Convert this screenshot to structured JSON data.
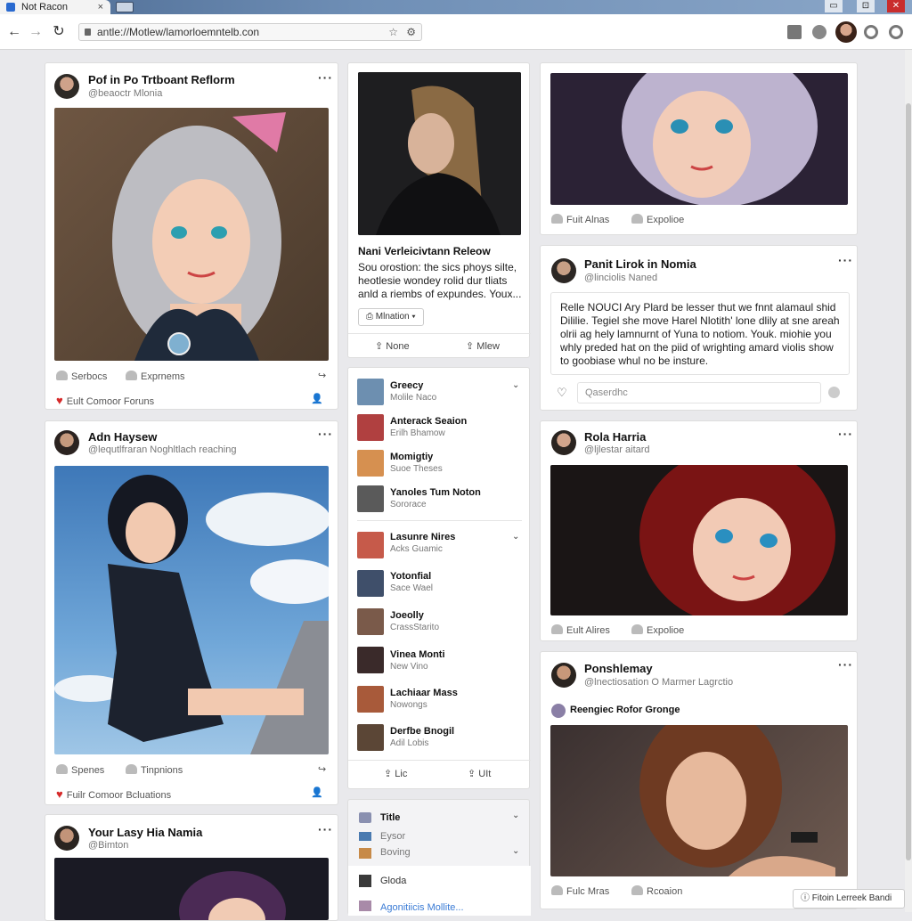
{
  "browser": {
    "tab_title": "Not Racon",
    "url": "antle://Motlew/lamorloemntelb.con",
    "win_controls": [
      "▭",
      "⊡",
      "✕"
    ]
  },
  "colors": {
    "accent": "#2a6ad0",
    "heart": "#d62a2a",
    "link": "#3a7bd5"
  },
  "col1": {
    "post1": {
      "title": "Pof in Po Trtboant Reflorm",
      "handle": "@beaoctr Mlonia",
      "actions": [
        "Serbocs",
        "Exprnems"
      ],
      "footer": "Eult Comoor Foruns"
    },
    "post2": {
      "title": "Adn Haysew",
      "handle": "@lequtlfraran Noghltlach reaching",
      "actions": [
        "Spenes",
        "Tinpnions"
      ],
      "footer": "Fuilr Comoor Bcluations"
    },
    "post3": {
      "title": "Your Lasy Hia Namia",
      "handle": "@Bimton"
    }
  },
  "col2": {
    "article": {
      "title": "Nani Verleicivtann Releow",
      "body": "Sou orostion: the sics phoys silte, heotlesie wondey rolid dur tliats anld a riembs of expundes. Youx...",
      "tag_button": "Mlnation",
      "btn_left": "None",
      "btn_right": "Mlew"
    },
    "people": [
      {
        "name": "Greecy",
        "sub": "Molile Naco"
      },
      {
        "name": "Anterack Seaion",
        "sub": "Erilh Bhamow"
      },
      {
        "name": "Momigtiy",
        "sub": "Suoe Theses"
      },
      {
        "name": "Yanoles Tum Noton",
        "sub": "Sororace"
      },
      {
        "name": "Lasunre Nires",
        "sub": "Acks Guamic"
      },
      {
        "name": "Yotonfial",
        "sub": "Sace Wael"
      },
      {
        "name": "Joeolly",
        "sub": "CrassStarito"
      },
      {
        "name": "Vinea Monti",
        "sub": "New Vino"
      },
      {
        "name": "Lachiaar Mass",
        "sub": "Nowongs"
      },
      {
        "name": "Derfbe Bnogil",
        "sub": "Adil Lobis"
      }
    ],
    "people_btn_left": "Lic",
    "people_btn_right": "UIt",
    "bottom": {
      "title": "Title",
      "items": [
        "Eysor",
        "Boving",
        "Gloda"
      ],
      "link": "Agonitiicis Mollite..."
    }
  },
  "col3": {
    "top": {
      "actions": [
        "Fuit Alnas",
        "Expolioe"
      ]
    },
    "post": {
      "title": "Panit Lirok in Nomia",
      "handle": "@linciolis Naned",
      "body": "Relle NOUCI Ary Plard be lesser thut we fnnt alamaul shid Dililie. Tegiel she move Harel Nlotith' lone dlily at sne areah olrii ag hely lamnurnt of Yuna to notiom. Youk. miohie you whly preded hat on the piid of wrighting amard violis show to goobiase whul no be insture.",
      "comment_placeholder": "Qaserdhc"
    },
    "post2": {
      "title": "Rola Harria",
      "handle": "@ljlestar aitard",
      "actions": [
        "Eult Alires",
        "Expolioe"
      ]
    },
    "post3": {
      "title": "Ponshlemay",
      "handle": "@lnectiosation O Marmer Lagrctio",
      "group": "Reengiec Rofor Gronge",
      "actions": [
        "Fulc Mras",
        "Rcoaion"
      ]
    },
    "toast": "Fitoin Lerreek Bandi"
  }
}
